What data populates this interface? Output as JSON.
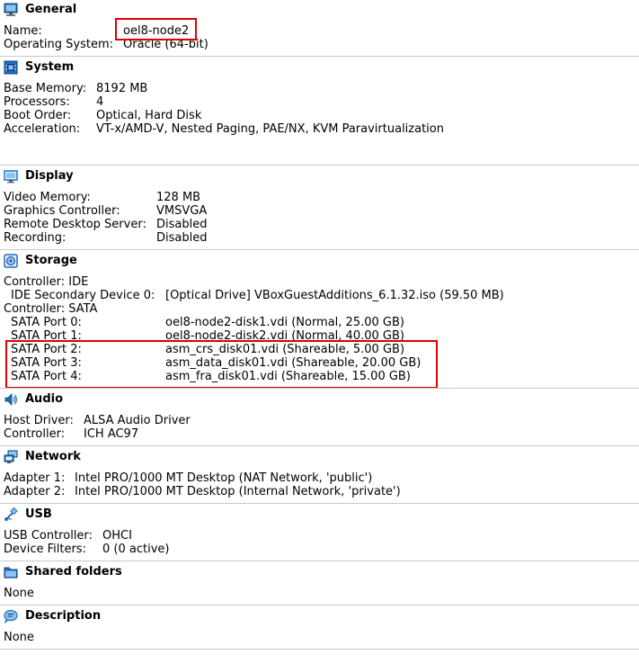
{
  "colors": {
    "highlight": "#e00000",
    "separator": "#c8c8c8",
    "icon_blue": "#1e6fc7"
  },
  "general": {
    "title": "General",
    "icon": "monitor-icon",
    "rows": [
      {
        "key": "Name:",
        "value": "oel8-node2"
      },
      {
        "key": "Operating System:",
        "value": "Oracle (64-bit)"
      }
    ]
  },
  "system": {
    "title": "System",
    "icon": "chip-icon",
    "rows": [
      {
        "key": "Base Memory:",
        "value": "8192 MB"
      },
      {
        "key": "Processors:",
        "value": "4"
      },
      {
        "key": "Boot Order:",
        "value": "Optical, Hard Disk"
      },
      {
        "key": "Acceleration:",
        "value": "VT-x/AMD-V, Nested Paging, PAE/NX, KVM Paravirtualization"
      }
    ]
  },
  "display": {
    "title": "Display",
    "icon": "display-icon",
    "rows": [
      {
        "key": "Video Memory:",
        "value": "128 MB"
      },
      {
        "key": "Graphics Controller:",
        "value": "VMSVGA"
      },
      {
        "key": "Remote Desktop Server:",
        "value": "Disabled"
      },
      {
        "key": "Recording:",
        "value": "Disabled"
      }
    ]
  },
  "storage": {
    "title": "Storage",
    "icon": "storage-icon",
    "rows": [
      {
        "key": "Controller: IDE",
        "value": ""
      },
      {
        "key": "IDE Secondary Device 0:",
        "value": "[Optical Drive] VBoxGuestAdditions_6.1.32.iso (59.50 MB)"
      },
      {
        "key": "Controller: SATA",
        "value": ""
      },
      {
        "key": "SATA Port 0:",
        "value": "oel8-node2-disk1.vdi (Normal, 25.00 GB)"
      },
      {
        "key": "SATA Port 1:",
        "value": "oel8-node2-disk2.vdi (Normal, 40.00 GB)"
      },
      {
        "key": "SATA Port 2:",
        "value": "asm_crs_disk01.vdi (Shareable, 5.00 GB)"
      },
      {
        "key": "SATA Port 3:",
        "value": "asm_data_disk01.vdi (Shareable, 20.00 GB)"
      },
      {
        "key": "SATA Port 4:",
        "value": "asm_fra_disk01.vdi (Shareable, 15.00 GB)"
      }
    ]
  },
  "audio": {
    "title": "Audio",
    "icon": "speaker-icon",
    "rows": [
      {
        "key": "Host Driver:",
        "value": "ALSA Audio Driver"
      },
      {
        "key": "Controller:",
        "value": "ICH AC97"
      }
    ]
  },
  "network": {
    "title": "Network",
    "icon": "network-icon",
    "rows": [
      {
        "key": "Adapter 1:",
        "value": "Intel PRO/1000 MT Desktop (NAT Network, 'public')"
      },
      {
        "key": "Adapter 2:",
        "value": "Intel PRO/1000 MT Desktop (Internal Network, 'private')"
      }
    ]
  },
  "usb": {
    "title": "USB",
    "icon": "usb-icon",
    "rows": [
      {
        "key": "USB Controller:",
        "value": "OHCI"
      },
      {
        "key": "Device Filters:",
        "value": "0 (0 active)"
      }
    ]
  },
  "shared_folders": {
    "title": "Shared folders",
    "icon": "folder-icon",
    "rows": [
      {
        "key": "None",
        "value": ""
      }
    ]
  },
  "description": {
    "title": "Description",
    "icon": "speech-bubble-icon",
    "rows": [
      {
        "key": "None",
        "value": ""
      }
    ]
  }
}
